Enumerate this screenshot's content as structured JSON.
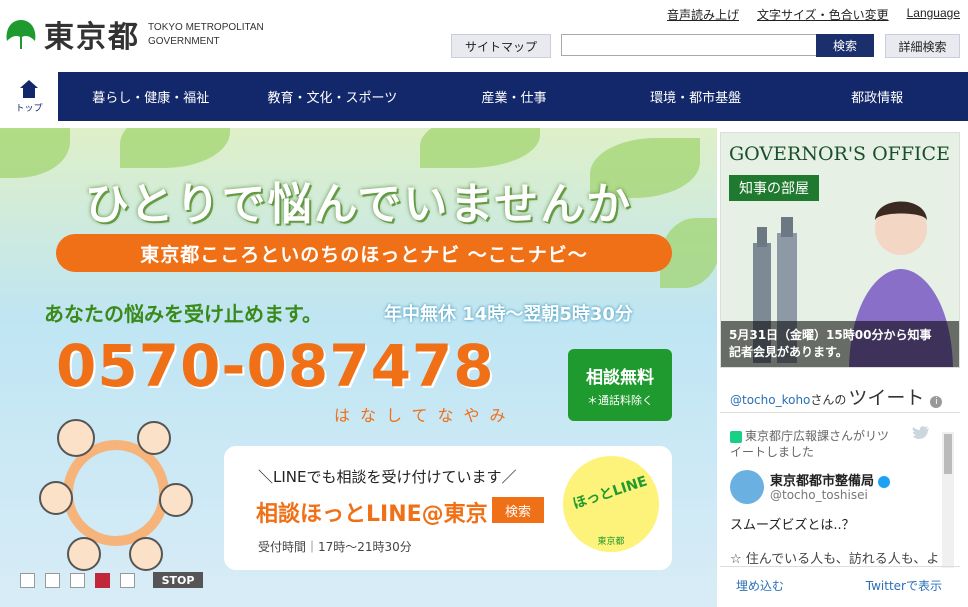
{
  "header": {
    "logo_jp": "東京都",
    "logo_en_line1": "TOKYO METROPOLITAN",
    "logo_en_line2": "GOVERNMENT",
    "util_links": [
      "音声読み上げ",
      "文字サイズ・色合い変更",
      "Language"
    ],
    "sitemap_label": "サイトマップ",
    "search_value": "",
    "search_button": "検索",
    "advanced_search": "詳細検索"
  },
  "nav": {
    "home_label": "トップ",
    "items": [
      "暮らし・健康・福祉",
      "教育・文化・スポーツ",
      "産業・仕事",
      "環境・都市基盤",
      "都政情報"
    ]
  },
  "banner": {
    "title": "ひとりで悩んでいませんか",
    "pill": "東京都こころといのちのほっとナビ ～ここナビ～",
    "sub1": "あなたの悩みを受け止めます。",
    "sub2": "年中無休 14時～翌朝5時30分",
    "phone": "0570-087478",
    "phone_reading": "はなしてなやみ",
    "free_line1": "相談無料",
    "free_line2": "＊通話料除く",
    "line_heading": "＼LINEでも相談を受け付けています／",
    "line_name": "相談ほっとLINE@東京",
    "line_search": "検索",
    "line_time": "受付時間｜17時～21時30分",
    "line_badge": "ほっとLINE",
    "line_badge_sub": "東京都",
    "stop_label": "STOP",
    "slides": 5,
    "active_slide": 4
  },
  "governor": {
    "title": "GOVERNOR'S OFFICE",
    "tag": "知事の部屋",
    "caption_line1": "5月31日（金曜）15時00分から知事",
    "caption_line2": "記者会見があります。"
  },
  "twitter": {
    "account": "@tocho_koho",
    "san": "さんの",
    "tweets_label": "ツイート",
    "retweet_line1": "東京都庁広報課さんがリツ",
    "retweet_line2": "イートしました",
    "user_name": "東京都都市整備局",
    "user_handle": "@tocho_toshisei",
    "text1": "スムーズビズとは..？",
    "text2": "☆ 住んでいる人も、訪れる人も、よ",
    "embed_label": "埋め込む",
    "show_label": "Twitterで表示"
  },
  "colors": {
    "nav": "#13286b",
    "accent_orange": "#f07017",
    "green": "#1f9a2f"
  }
}
